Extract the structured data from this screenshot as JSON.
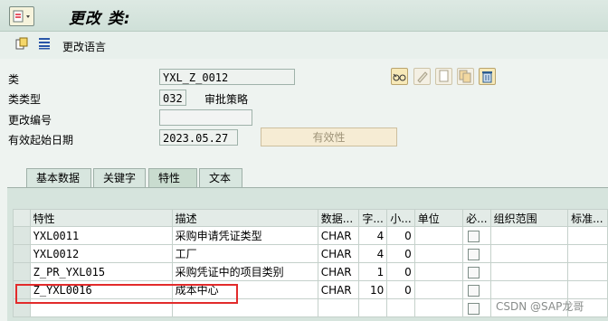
{
  "titlebar": {
    "title": "更改 类:"
  },
  "toolbar": {
    "change_language_label": "更改语言"
  },
  "form": {
    "class_label": "类",
    "class_value": "YXL_Z_0012",
    "class_type_label": "类类型",
    "class_type_value": "032",
    "class_type_desc": "审批策略",
    "change_number_label": "更改编号",
    "change_number_value": "",
    "valid_from_label": "有效起始日期",
    "valid_from_value": "2023.05.27",
    "validity_button": "有效性"
  },
  "tabs": [
    {
      "label": "基本数据"
    },
    {
      "label": "关键字"
    },
    {
      "label": "特性"
    },
    {
      "label": "文本"
    }
  ],
  "table": {
    "headers": [
      "特性",
      "描述",
      "数据...",
      "字...",
      "小...",
      "单位",
      "必...",
      "组织范围",
      "标准..."
    ],
    "rows": [
      {
        "char": "YXL0011",
        "desc": "采购申请凭证类型",
        "type": "CHAR",
        "len": "4",
        "dec": "0"
      },
      {
        "char": "YXL0012",
        "desc": "工厂",
        "type": "CHAR",
        "len": "4",
        "dec": "0"
      },
      {
        "char": "Z_PR_YXL015",
        "desc": "采购凭证中的项目类别",
        "type": "CHAR",
        "len": "1",
        "dec": "0"
      },
      {
        "char": "Z_YXL0016",
        "desc": "成本中心",
        "type": "CHAR",
        "len": "10",
        "dec": "0"
      }
    ]
  },
  "watermark": "CSDN @SAP龙哥"
}
